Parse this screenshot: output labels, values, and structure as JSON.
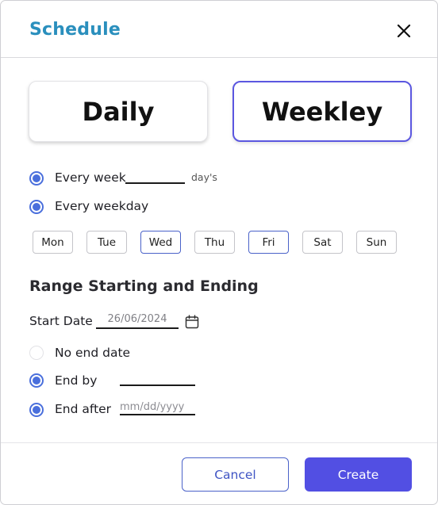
{
  "dialog": {
    "title": "Schedule",
    "close_icon": "close-icon"
  },
  "modes": {
    "daily_label": "Daily",
    "weekly_label": "Weekley",
    "selected": "Weekley"
  },
  "recurrence": {
    "every_week_label": "Every week",
    "every_week_value": "",
    "every_week_suffix": "day's",
    "every_weekday_label": "Every weekday",
    "every_week_checked": true,
    "every_weekday_checked": true
  },
  "days": [
    {
      "label": "Mon",
      "selected": false
    },
    {
      "label": "Tue",
      "selected": false
    },
    {
      "label": "Wed",
      "selected": true
    },
    {
      "label": "Thu",
      "selected": false
    },
    {
      "label": "Fri",
      "selected": true
    },
    {
      "label": "Sat",
      "selected": false
    },
    {
      "label": "Sun",
      "selected": false
    }
  ],
  "range": {
    "title": "Range Starting and Ending",
    "start_date_label": "Start Date",
    "start_date_value": "26/06/2024",
    "calendar_icon": "calendar-icon",
    "no_end_date_label": "No end date",
    "no_end_date_checked": false,
    "end_by_label": "End by",
    "end_by_checked": true,
    "end_by_value": "",
    "end_after_label": "End after",
    "end_after_checked": true,
    "end_after_placeholder": "mm/dd/yyyy"
  },
  "footer": {
    "cancel_label": "Cancel",
    "create_label": "Create"
  },
  "colors": {
    "title": "#2a8fbd",
    "accent": "#524fe3",
    "radio": "#4a6fdc",
    "selected_border": "#5b57e0"
  }
}
